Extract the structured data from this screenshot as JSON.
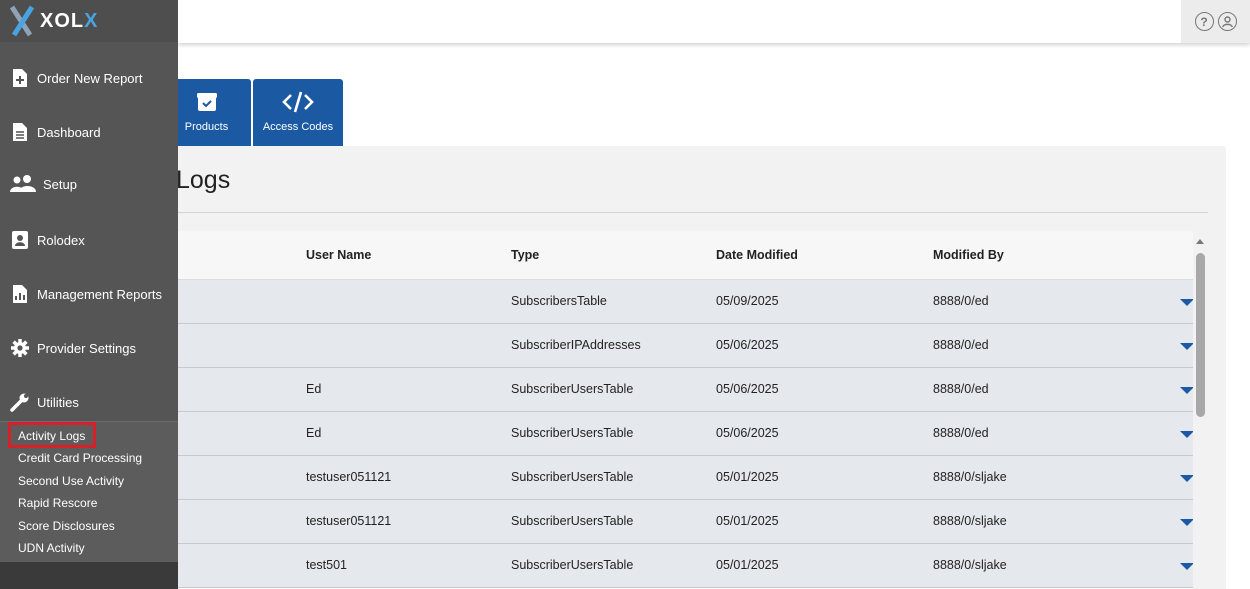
{
  "app": {
    "logo": "XOL",
    "logo_accent": "X"
  },
  "sidebar": {
    "items": [
      {
        "label": "Order New Report",
        "icon": "file-plus-icon"
      },
      {
        "label": "Dashboard",
        "icon": "document-icon"
      },
      {
        "label": "Setup",
        "icon": "users-icon"
      },
      {
        "label": "Rolodex",
        "icon": "contact-card-icon"
      },
      {
        "label": "Management Reports",
        "icon": "chart-report-icon"
      },
      {
        "label": "Provider Settings",
        "icon": "gear-icon"
      },
      {
        "label": "Utilities",
        "icon": "wrench-icon"
      }
    ],
    "submenu": [
      {
        "label": "Activity Logs",
        "active": true
      },
      {
        "label": "Credit Card Processing"
      },
      {
        "label": "Second Use Activity"
      },
      {
        "label": "Rapid Rescore"
      },
      {
        "label": "Score Disclosures"
      },
      {
        "label": "UDN Activity"
      }
    ]
  },
  "topbar": {
    "help_icon": "?",
    "user_icon": "user-circle-icon"
  },
  "tabs": [
    {
      "label": "Products",
      "icon": "box-check-icon"
    },
    {
      "label": "Access Codes",
      "icon": "code-icon"
    }
  ],
  "main": {
    "title": "Logs",
    "columns": [
      "User Name",
      "Type",
      "Date Modified",
      "Modified By"
    ],
    "rows": [
      {
        "user": "",
        "type": "SubscribersTable",
        "date": "05/09/2025",
        "modified_by": "8888/0/ed"
      },
      {
        "user": "",
        "type": "SubscriberIPAddresses",
        "date": "05/06/2025",
        "modified_by": "8888/0/ed"
      },
      {
        "user": "Ed",
        "type": "SubscriberUsersTable",
        "date": "05/06/2025",
        "modified_by": "8888/0/ed"
      },
      {
        "user": "Ed",
        "type": "SubscriberUsersTable",
        "date": "05/06/2025",
        "modified_by": "8888/0/ed"
      },
      {
        "user": "testuser051121",
        "type": "SubscriberUsersTable",
        "date": "05/01/2025",
        "modified_by": "8888/0/sljake"
      },
      {
        "user": "testuser051121",
        "type": "SubscriberUsersTable",
        "date": "05/01/2025",
        "modified_by": "8888/0/sljake"
      },
      {
        "user": "test501",
        "type": "SubscriberUsersTable",
        "date": "05/01/2025",
        "modified_by": "8888/0/sljake"
      }
    ]
  },
  "colors": {
    "sidebar_bg": "#555555",
    "tab_blue": "#1b5aa3",
    "active_outline": "#d8202a",
    "row_bg": "#e5e8ec"
  }
}
